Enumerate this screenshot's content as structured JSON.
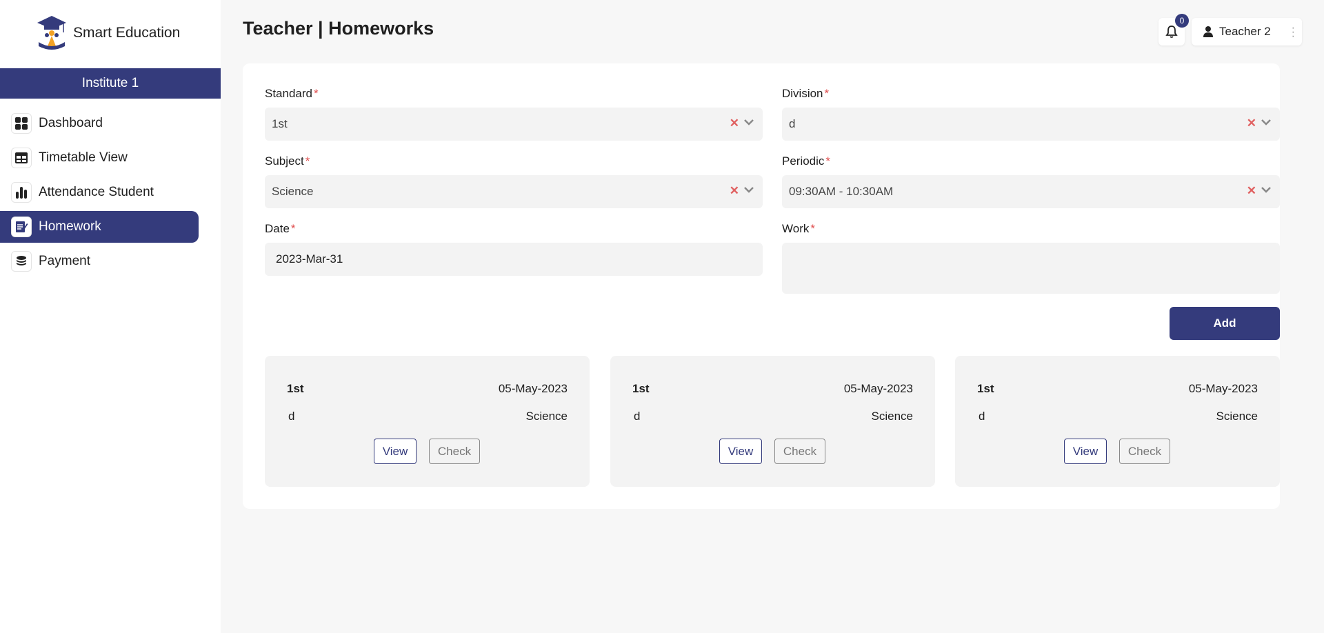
{
  "brand": {
    "name": "Smart Education",
    "institute": "Institute 1"
  },
  "sidebar": {
    "items": [
      {
        "label": "Dashboard",
        "icon": "dashboard-grid-icon"
      },
      {
        "label": "Timetable View",
        "icon": "table-icon"
      },
      {
        "label": "Attendance Student",
        "icon": "bar-chart-icon"
      },
      {
        "label": "Homework",
        "icon": "homework-icon",
        "active": true
      },
      {
        "label": "Payment",
        "icon": "coins-icon"
      }
    ]
  },
  "header": {
    "title": "Teacher | Homeworks",
    "notifications": "0",
    "user": "Teacher 2"
  },
  "form": {
    "standard": {
      "label": "Standard",
      "required": "*",
      "value": "1st"
    },
    "division": {
      "label": "Division",
      "required": "*",
      "value": "d"
    },
    "subject": {
      "label": "Subject",
      "required": "*",
      "value": "Science"
    },
    "periodic": {
      "label": "Periodic",
      "required": "*",
      "value": "09:30AM - 10:30AM"
    },
    "date": {
      "label": "Date",
      "required": "*",
      "value": "2023-Mar-31"
    },
    "work": {
      "label": "Work",
      "required": "*",
      "value": ""
    },
    "add_label": "Add"
  },
  "homeworks": [
    {
      "standard": "1st",
      "date": "05-May-2023",
      "division": "d",
      "subject": "Science",
      "view_label": "View",
      "check_label": "Check"
    },
    {
      "standard": "1st",
      "date": "05-May-2023",
      "division": "d",
      "subject": "Science",
      "view_label": "View",
      "check_label": "Check"
    },
    {
      "standard": "1st",
      "date": "05-May-2023",
      "division": "d",
      "subject": "Science",
      "view_label": "View",
      "check_label": "Check"
    }
  ],
  "colors": {
    "primary": "#343b7c",
    "clear": "#e06060",
    "required": "#e05050"
  }
}
